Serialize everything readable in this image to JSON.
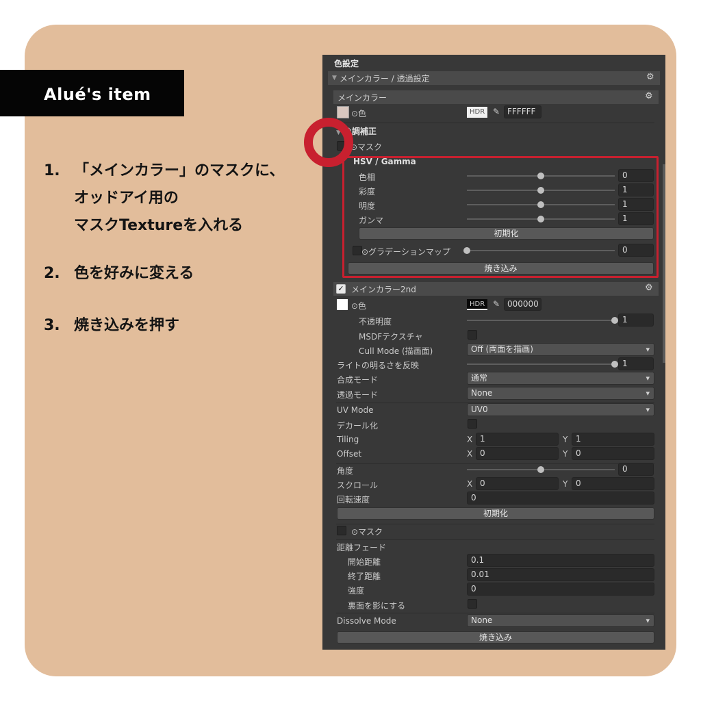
{
  "badge": "Alué's item",
  "steps": [
    {
      "num": "1.",
      "text": "「メインカラー」のマスクに、\nオッドアイ用の\nマスクTextureを入れる"
    },
    {
      "num": "2.",
      "text": "色を好みに変える"
    },
    {
      "num": "3.",
      "text": "焼き込みを押す"
    }
  ],
  "panel": {
    "title": "色設定",
    "section_header": "メインカラー / 透過設定",
    "main_color": {
      "header": "メインカラー",
      "color_label": "⊙色",
      "hdr": "HDR",
      "hex": "FFFFFF",
      "tone_header": "色調補正",
      "mask_label": "⊙マスク",
      "hsv_header": "HSV / Gamma",
      "sliders": [
        {
          "label": "色相",
          "value": "0",
          "fraction": 0.5
        },
        {
          "label": "彩度",
          "value": "1",
          "fraction": 0.5
        },
        {
          "label": "明度",
          "value": "1",
          "fraction": 0.5
        },
        {
          "label": "ガンマ",
          "value": "1",
          "fraction": 0.5
        }
      ],
      "reset": "初期化",
      "gradient_label": "⊙グラデーションマップ",
      "gradient_value": "0",
      "gradient_fraction": 0.0,
      "bake": "焼き込み"
    },
    "main_color_2nd": {
      "header": "メインカラー2nd",
      "color_label": "⊙色",
      "hdr": "HDR",
      "hex": "000000",
      "opacity_label": "不透明度",
      "opacity_value": "1",
      "opacity_fraction": 1.0,
      "msdf_label": "MSDFテクスチャ",
      "cull_label": "Cull Mode (描画面)",
      "cull_value": "Off (両面を描画)",
      "light_label": "ライトの明るさを反映",
      "light_value": "1",
      "light_fraction": 1.0,
      "blend_label": "合成モード",
      "blend_value": "通常",
      "alpha_label": "透過モード",
      "alpha_value": "None",
      "uv_label": "UV Mode",
      "uv_value": "UV0",
      "decal_label": "デカール化",
      "tiling_label": "Tiling",
      "tiling_x": "1",
      "tiling_y": "1",
      "offset_label": "Offset",
      "offset_x": "0",
      "offset_y": "0",
      "angle_label": "角度",
      "angle_value": "0",
      "angle_fraction": 0.5,
      "scroll_label": "スクロール",
      "scroll_x": "0",
      "scroll_y": "0",
      "rotate_label": "回転速度",
      "rotate_value": "0",
      "reset": "初期化",
      "mask_label": "⊙マスク",
      "fade_label": "距離フェード",
      "fade_start_label": "開始距離",
      "fade_start": "0.1",
      "fade_end_label": "終了距離",
      "fade_end": "0.01",
      "strength_label": "強度",
      "strength": "0",
      "backface_label": "裏面を影にする",
      "dissolve_label": "Dissolve Mode",
      "dissolve_value": "None",
      "bake": "焼き込み"
    },
    "axis_x": "X",
    "axis_y": "Y"
  },
  "colors": {
    "card": "#e2bd9b",
    "panel": "#383838",
    "highlight": "#c8202f"
  },
  "icons": [
    "gear-icon",
    "eyedropper-icon",
    "foldout-arrow-icon",
    "checkbox-icon"
  ]
}
